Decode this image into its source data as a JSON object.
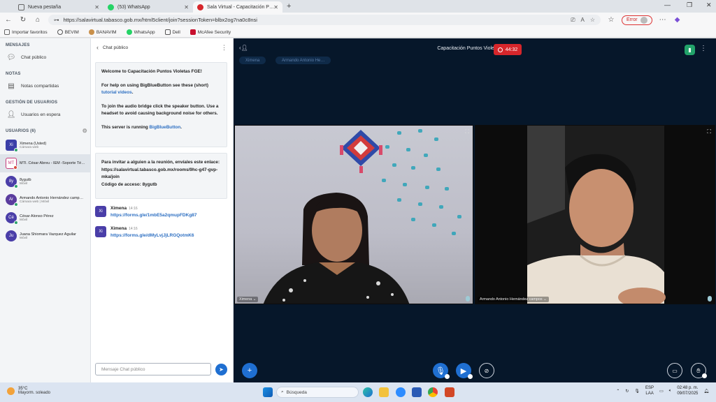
{
  "browser": {
    "tabs": [
      {
        "label": "Nueva pestaña",
        "active": false
      },
      {
        "label": "(53) WhatsApp",
        "active": false
      },
      {
        "label": "Sala Virtual - Capacitación P…",
        "active": true
      }
    ],
    "new_tab": "+",
    "url": "https://salavirtual.tabasco.gob.mx/html5client/join?sessionToken=blbx2og7na0c8nsi",
    "error_label": "Error",
    "bookmarks": [
      "Importar favoritos",
      "BEVIM",
      "BANAVIM",
      "WhatsApp",
      "Dell",
      "McAfee Security"
    ]
  },
  "left_panel": {
    "messages_title": "MENSAJES",
    "public_chat": "Chat público",
    "notes_title": "NOTAS",
    "shared_notes": "Notas compartidas",
    "user_mgmt_title": "GESTIÓN DE USUARIOS",
    "waiting_users": "Usuarios en espera",
    "users_title": "USUARIOS (6)",
    "users": [
      {
        "initials": "Xi",
        "name": "Ximena (Usted)",
        "sub": "Cámara web",
        "color": "#3b3fa8",
        "status": "#2fa36b"
      },
      {
        "initials": "MT",
        "name": "MTI. César Abreu - IEM -Soporte Téc…",
        "sub": "",
        "color": "#c53a7a",
        "status": "#d94a3a"
      },
      {
        "initials": "8y",
        "name": "8ygutb",
        "sub": "Móvil",
        "color": "#4a3ea8",
        "status": "#2fa36b"
      },
      {
        "initials": "Ar",
        "name": "Armando Antonio Hernández camp…",
        "sub": "Cámara web | Móvil",
        "color": "#5a3c9e",
        "status": "#2fa36b"
      },
      {
        "initials": "Cé",
        "name": "César Alonso Pérez",
        "sub": "Móvil",
        "color": "#4a3ea8",
        "status": "#2fa36b"
      },
      {
        "initials": "Ju",
        "name": "Juana Shiomara Vazquez Aguilar",
        "sub": "Móvil",
        "color": "#4a3ea8",
        "status": ""
      }
    ]
  },
  "chat": {
    "header": "Chat público",
    "welcome": {
      "title": "Welcome to Capacitación Puntos Violetas FGE!",
      "help_pre": "For help on using BigBlueButton see these (short)",
      "help_link": "tutorial videos",
      "help_post": ".",
      "audio": "To join the audio bridge click the speaker button. Use a headset to avoid causing background noise for others.",
      "server_pre": "This server is running ",
      "server_link": "BigBlueButton",
      "server_post": "."
    },
    "invite": {
      "line1": "Para invitar a alguien a la reunión, envíales este enlace:",
      "link": "https://salavirtual.tabasco.gob.mx/rooms/9hc-g47-gvp-mka/join",
      "code": "Código de acceso: 8ygutb"
    },
    "messages": [
      {
        "initials": "Xi",
        "author": "Ximena",
        "time": "14:16",
        "text": "https://forms.gle/1mbE5a2qmupFDKg87"
      },
      {
        "initials": "Xi",
        "author": "Ximena",
        "time": "14:16",
        "text": "https://forms.gle/dMyLvjJjLRGQotmK6"
      }
    ],
    "input_placeholder": "Mensaje Chat público"
  },
  "meeting": {
    "title": "Capacitación Puntos Violetas FGE",
    "timer": "44:32",
    "talkers": [
      "Ximena",
      "Armando Antonio He…"
    ],
    "videos": [
      {
        "label": "Ximena"
      },
      {
        "label": "Armando Antonio Hernández campos"
      }
    ]
  },
  "taskbar": {
    "temp": "35°C",
    "weather": "Mayorm. soleado",
    "search": "Búsqueda",
    "lang1": "ESP",
    "lang2": "LAA",
    "time": "02:48 p. m.",
    "date": "09/07/2025"
  },
  "colors": {
    "accent": "#1f6fd1",
    "record": "#d6262b",
    "main_bg": "#06172a"
  }
}
